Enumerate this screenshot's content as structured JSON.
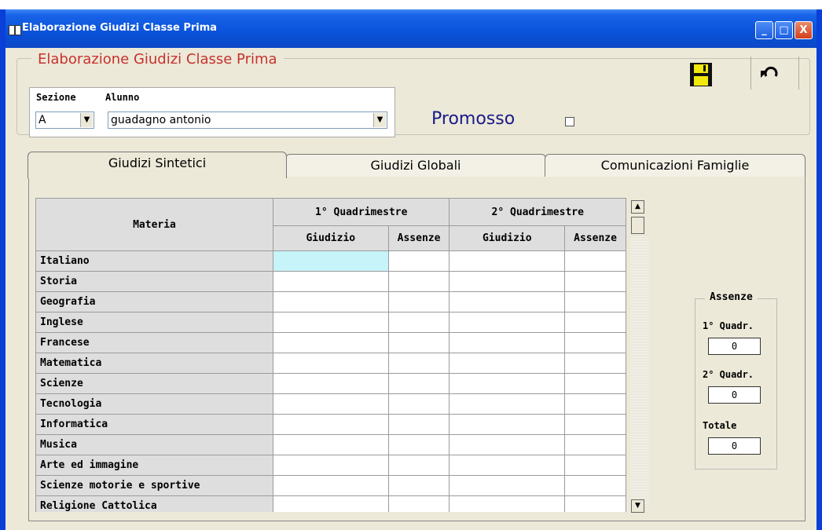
{
  "window": {
    "title": "Elaborazione Giudizi Classe Prima",
    "btn_min": "_",
    "btn_max": "□",
    "btn_close": "X"
  },
  "form": {
    "group_title": "Elaborazione Giudizi Classe Prima",
    "sezione_label": "Sezione",
    "sezione_value": "A",
    "alunno_label": "Alunno",
    "alunno_value": "guadagno antonio",
    "promosso_label": "Promosso",
    "promosso_checked": false
  },
  "tabs": [
    {
      "label": "Giudizi Sintetici",
      "active": true
    },
    {
      "label": "Giudizi Globali",
      "active": false
    },
    {
      "label": "Comunicazioni Famiglie",
      "active": false
    }
  ],
  "grid": {
    "col_materia": "Materia",
    "q1": "1° Quadrimestre",
    "q2": "2° Quadrimestre",
    "giudizio": "Giudizio",
    "assenze": "Assenze",
    "rows": [
      "Italiano",
      "Storia",
      "Geografia",
      "Inglese",
      "Francese",
      "Matematica",
      "Scienze",
      "Tecnologia",
      "Informatica",
      "Musica",
      "Arte ed immagine",
      "Scienze motorie e sportive",
      "Religione Cattolica"
    ]
  },
  "assenze": {
    "title": "Assenze",
    "q1_label": "1° Quadr.",
    "q1_value": "0",
    "q2_label": "2° Quadr.",
    "q2_value": "0",
    "tot_label": "Totale",
    "tot_value": "0"
  },
  "icons": {
    "save": "floppy-disk-icon",
    "undo": "undo-arrow-icon",
    "scroll_up": "▲",
    "scroll_down": "▼",
    "combo_arrow": "▼"
  }
}
